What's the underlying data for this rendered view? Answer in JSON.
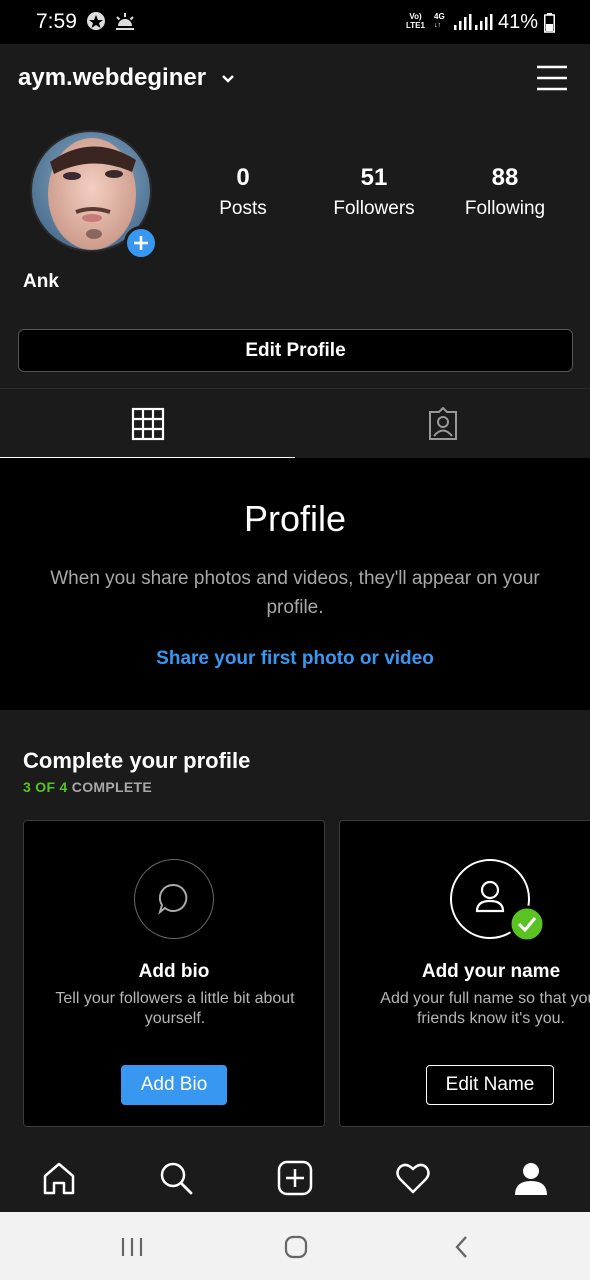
{
  "status_bar": {
    "time": "7:59",
    "network_line1": "Vo)",
    "network_line2": "LTE1",
    "network_type": "4G",
    "battery_percent": "41%"
  },
  "header": {
    "username": "aym.webdeginer"
  },
  "profile": {
    "display_name": "Ank",
    "stats": [
      {
        "value": "0",
        "label": "Posts"
      },
      {
        "value": "51",
        "label": "Followers"
      },
      {
        "value": "88",
        "label": "Following"
      }
    ],
    "edit_button": "Edit Profile"
  },
  "empty_state": {
    "title": "Profile",
    "description": "When you share photos and videos, they'll appear on your profile.",
    "link": "Share your first photo or video"
  },
  "complete_profile": {
    "title": "Complete your profile",
    "progress_done": "3 OF 4",
    "progress_label": "COMPLETE",
    "cards": [
      {
        "title": "Add bio",
        "description": "Tell your followers a little bit about yourself.",
        "button": "Add Bio"
      },
      {
        "title": "Add your name",
        "description": "Add your full name so that your friends know it's you.",
        "button": "Edit Name"
      }
    ]
  },
  "colors": {
    "accent_blue": "#3897f0",
    "complete_green": "#58c322",
    "background": "#1b1b1b"
  }
}
